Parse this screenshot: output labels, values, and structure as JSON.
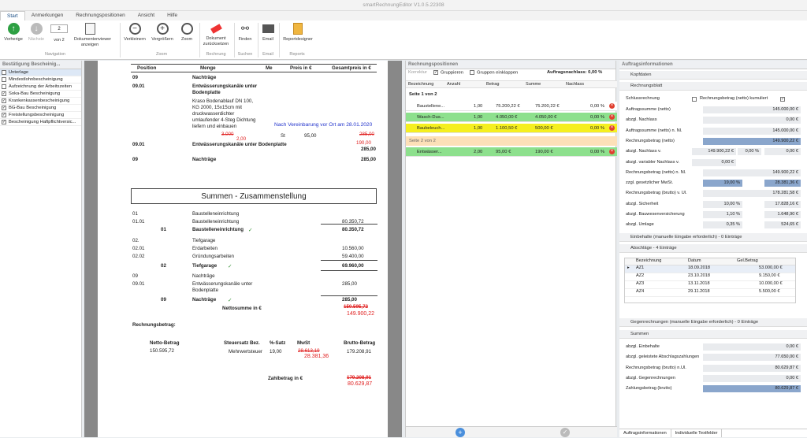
{
  "app": {
    "title": "smartRechnungEditor  V1.0.5.22308"
  },
  "menu": [
    "Start",
    "Anmerkungen",
    "Rechnungspositionen",
    "Ansicht",
    "Hilfe"
  ],
  "ribbon": {
    "vorherige": "Vorherige",
    "naechste": "Nächste",
    "page_value": "2",
    "von": "von 2",
    "dokviewer": "Dokumentenviewer anzeigen",
    "verkleinern": "Verkleinern",
    "vergroessern": "Vergrößern",
    "zoom": "Zoom",
    "reset": "Dokument zurücksetzen",
    "finden": "Finden",
    "email": "Email",
    "reportdesigner": "Reportdesigner",
    "grp_navigation": "Navigation",
    "grp_zoom": "Zoom",
    "grp_rechnung": "Rechnung",
    "grp_suchen": "Suchen",
    "grp_email": "Email",
    "grp_reports": "Reports"
  },
  "left": {
    "title": "Bestätigung Bescheinig...",
    "items": [
      {
        "label": "Unterlage",
        "checked": false,
        "selected": true
      },
      {
        "label": "Mindestlohnbescheinigung",
        "checked": false
      },
      {
        "label": "Aufzeichnung der Arbeitszeiten",
        "checked": false
      },
      {
        "label": "Soka-Bau Bescheinigung",
        "checked": true
      },
      {
        "label": "Krankenkassenbescheinigung",
        "checked": true
      },
      {
        "label": "BG-Bau Bescheinigung",
        "checked": true
      },
      {
        "label": "Freistellungsbescheinigung",
        "checked": true
      },
      {
        "label": "Bescheinigung Haftpflichtversic...",
        "checked": true
      }
    ]
  },
  "doc": {
    "hdr": [
      "Position",
      "Menge",
      "Me",
      "Preis in €",
      "Gesamtpreis in €"
    ],
    "r1": {
      "pos": "09",
      "text": "Nachträge"
    },
    "r2": {
      "pos": "09.01",
      "text": "Entwässerungskanäle unter Bodenplatte"
    },
    "r3": [
      "Kraso Bodenablauf DN 100,",
      "KG 2000, 15x15cm mit",
      "druckwasserdichter",
      "umlaufender 4-Steg Dichtung",
      "liefern und einbauen"
    ],
    "note": "Nach Vereinbarung vor Ort am 28.01.2020",
    "menge_old": "3,000",
    "menge_new": "2,00",
    "me": "St",
    "preis": "95,00",
    "gesamt_old": "285,00",
    "gesamt_new": "190,00",
    "r4": {
      "pos": "09.01",
      "text": "Entwässerungskanäle unter Bodenplatte",
      "val": "285,00"
    },
    "r5": {
      "pos": "09",
      "text": "Nachträge",
      "val": "285,00"
    },
    "summary_title": "Summen - Zusammenstellung",
    "s": [
      {
        "pos": "01",
        "text": "Baustelleneinrichtung",
        "val": ""
      },
      {
        "pos": "01.01",
        "text": "Baustelleneinrichtung",
        "val": "80.350,72"
      },
      {
        "pos": "01",
        "text": "Baustelleneinrichtung",
        "val": "80.350,72",
        "bold": true
      },
      {
        "pos": "02.",
        "text": "Tiefgarage",
        "val": ""
      },
      {
        "pos": "02.01",
        "text": "Erdarbeiten",
        "val": "10.560,00"
      },
      {
        "pos": "02.02",
        "text": "Gründungsarbeiten",
        "val": "59.400,00"
      },
      {
        "pos": "02",
        "text": "Tiefgarage",
        "val": "69.960,00",
        "bold": true
      },
      {
        "pos": "09",
        "text": "Nachträge",
        "val": ""
      },
      {
        "pos": "09.01",
        "text": "Entwässerungskanäle unter",
        "val": "285,00"
      },
      {
        "pos": "",
        "text": "Bodenplatte",
        "val": ""
      },
      {
        "pos": "09",
        "text": "Nachträge",
        "val": "285,00",
        "bold": true
      }
    ],
    "netto_label": "Nettosumme in €",
    "netto_old": "150.595,72",
    "netto_new": "149.900,22",
    "rb_label": "Rechnungsbetrag:",
    "rb_hdr": [
      "Netto-Betrag",
      "Steuersatz Bez.",
      "%-Satz",
      "MwSt",
      "Brutto-Betrag"
    ],
    "rb_vals": [
      "150.595,72",
      "Mehrwertsteuer",
      "19,00",
      "28.613,19",
      "179.208,91"
    ],
    "mwst_new": "28.381,36",
    "zahl_label": "Zahlbetrag in €",
    "zahl_old": "179.208,91",
    "zahl_new": "80.629,87"
  },
  "mid": {
    "title": "Rechnungspositionen",
    "korrektur": "Korrektur",
    "gruppieren": "Gruppieren",
    "einklappen": "Gruppen einklappen",
    "nachlass": "Auftragsnachlass: 0,00 %",
    "cols": [
      "Bezeichnung",
      "Anzahl",
      "Betrag",
      "Summe",
      "Nachlass"
    ],
    "g1": "Seite 1 von 2",
    "g2": "Seite 2 von 2",
    "rows": [
      {
        "bez": "Baustellene...",
        "anz": "1,00",
        "betrag": "75.200,22 €",
        "summe": "75.200,22 €",
        "nl": "0,00 %",
        "color": "#ffffff"
      },
      {
        "bez": "Wasch-Dus...",
        "anz": "1,00",
        "betrag": "4.050,00 €",
        "summe": "4.050,00 €",
        "nl": "0,00 %",
        "color": "#8de08d"
      },
      {
        "bez": "Baubeleuch...",
        "anz": "1,00",
        "betrag": "1.100,50 €",
        "summe": "500,00 €",
        "nl": "0,00 %",
        "color": "#f5ef20"
      },
      {
        "bez": "Entwässer...",
        "anz": "2,00",
        "betrag": "95,00 €",
        "summe": "190,00 €",
        "nl": "0,00 %",
        "color": "#8de08d"
      }
    ]
  },
  "right": {
    "title": "Auftragsinformationen",
    "kopf": "Kopfdaten",
    "rb": "Rechnungsblatt",
    "schluss": "Schlussrechnung",
    "kumuliert": "Rechnungsbetrag (netto) kumuliert",
    "rows": [
      {
        "l": "Auftragssumme (netto)",
        "v": "145.000,00 €"
      },
      {
        "l": "abzgl. Nachlass",
        "v": "0,00 €"
      },
      {
        "l": "Auftragssumme (netto) n. Nl.",
        "v": "145.000,00 €"
      },
      {
        "l": "Rechnungsbetrag (netto)",
        "v": "149.900,22 €",
        "blue": true
      },
      {
        "l": "abzgl. Nachlass v.",
        "v": "0,00 €",
        "a": "149.900,22 €",
        "b": "0,00 %"
      },
      {
        "l": "abzgl. variabler Nachlass v.",
        "v": "",
        "a": "0,00 €"
      },
      {
        "l": "Rechnungsbetrag (netto) n. Nl.",
        "v": "149.900,22 €"
      },
      {
        "l": "zzgl. gesetzlicher MwSt.",
        "v": "28.381,36 €",
        "blue": true,
        "b": "19,00 %",
        "bblue": true
      },
      {
        "l": "Rechnungsbetrag (brutto) v. Ul.",
        "v": "178.281,58 €"
      },
      {
        "l": "abzgl. Sicherheit",
        "v": "17.828,16 €",
        "b": "10,00 %"
      },
      {
        "l": "abzgl. Bauwesenversicherung",
        "v": "1.648,90 €",
        "b": "1,10 %"
      },
      {
        "l": "abzgl. Umlage",
        "v": "524,65 €",
        "b": "0,35 %"
      }
    ],
    "einbehalte": "Einbehalte (manuelle Eingabe erforderlich) - 0 Einträge",
    "abschlaege": "Abschläge - 4 Einträge",
    "ab_cols": [
      "Bezeichnung",
      "Datum",
      "Gel.Betrag"
    ],
    "ab_rows": [
      [
        "AZ1",
        "18.09.2018",
        "53.000,00 €"
      ],
      [
        "AZ2",
        "23.10.2018",
        "9.150,00 €"
      ],
      [
        "AZ3",
        "13.11.2018",
        "10.000,00 €"
      ],
      [
        "AZ4",
        "29.11.2018",
        "5.500,00 €"
      ]
    ],
    "gegen": "Gegenrechnungen (manuelle Eingabe erforderlich) - 0 Einträge",
    "summen": "Summen",
    "sum_rows": [
      {
        "l": "abzgl. Einbehalte",
        "v": "0,00 €"
      },
      {
        "l": "abzgl. geleistete Abschlagszahlungen",
        "v": "77.650,00 €"
      },
      {
        "l": "Rechnungsbetrag (brutto) n.Ul.",
        "v": "80.629,87 €"
      },
      {
        "l": "abzgl. Gegenrechnungen",
        "v": "0,00 €"
      },
      {
        "l": "Zahlungsbetrag (brutto)",
        "v": "80.629,87 €",
        "blue": true
      }
    ],
    "tab1": "Auftragsinformationen",
    "tab2": "Individuelle Textfelder"
  }
}
